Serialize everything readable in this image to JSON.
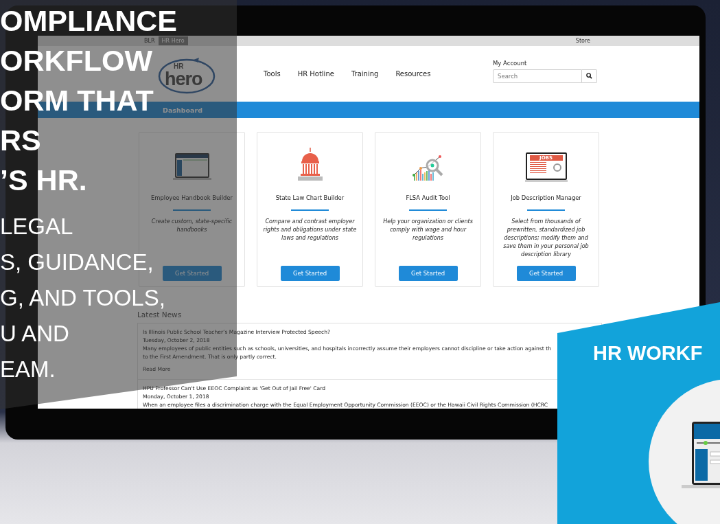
{
  "topbar": {
    "tabs": [
      {
        "label": "BLR",
        "selected": false
      },
      {
        "label": "HR Hero",
        "selected": true
      }
    ],
    "store": "Store"
  },
  "header": {
    "logo": {
      "prefix": "HR",
      "name": "hero"
    },
    "nav": [
      "Tools",
      "HR Hotline",
      "Training",
      "Resources"
    ],
    "account": "My Account",
    "search": {
      "placeholder": "Search"
    }
  },
  "dashboard_bar": {
    "label": "Dashboard"
  },
  "cards": [
    {
      "kind": "handbook",
      "title": "Employee Handbook Builder",
      "description": "Create custom, state-specific handbooks",
      "button": "Get Started"
    },
    {
      "kind": "capitol",
      "title": "State Law Chart Builder",
      "description": "Compare and contrast employer rights and obligations under state laws and regulations",
      "button": "Get Started"
    },
    {
      "kind": "audit",
      "title": "FLSA Audit Tool",
      "description": "Help your organization or clients comply with wage and hour regulations",
      "button": "Get Started"
    },
    {
      "kind": "jobs",
      "icon_text": "JOBS",
      "title": "Job Description Manager",
      "description": "Select from thousands of prewritten, standardized job descriptions; modify them and save them in your personal job description library",
      "button": "Get Started"
    }
  ],
  "news": {
    "title": "Latest News",
    "items": [
      {
        "headline": "Is Illinois Public School Teacher’s Magazine Interview Protected Speech?",
        "date": "Tuesday, October 2, 2018",
        "summary": [
          "Many employees of public entities such as schools, universities, and hospitals incorrectly assume their employers cannot discipline or take action against th",
          "to the First Amendment. That is only partly correct."
        ],
        "link": "Read More"
      },
      {
        "headline": "HPU Professor Can't Use EEOC Complaint as 'Get Out of Jail Free' Card",
        "date": "Monday, October 1, 2018",
        "summary": [
          "When an employee files a discrimination charge with the Equal Employment Opportunity Commission (EEOC) or the Hawaii Civil Rights Commission (HCRC"
        ]
      }
    ]
  },
  "promo_left": {
    "headline": [
      "OMPLIANCE",
      "ORKFLOW",
      "ORM THAT",
      "RS",
      "’S HR."
    ],
    "body": [
      "LEGAL",
      "S, GUIDANCE,",
      "G, AND TOOLS,",
      "U AND",
      "EAM."
    ]
  },
  "promo_right": {
    "title": "HR WORKF"
  }
}
